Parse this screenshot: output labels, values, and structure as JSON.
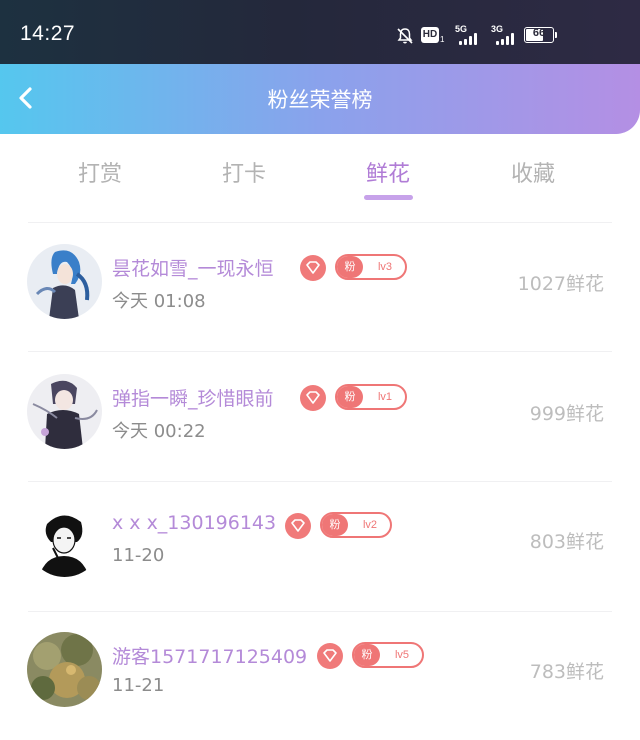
{
  "status_bar": {
    "time": "14:27",
    "hd_label": "HD",
    "hd_sub": "1",
    "network1": "5G",
    "network2": "3G",
    "battery": "66"
  },
  "header": {
    "title": "粉丝荣誉榜"
  },
  "tabs": [
    {
      "label": "打赏",
      "active": false
    },
    {
      "label": "打卡",
      "active": false
    },
    {
      "label": "鲜花",
      "active": true
    },
    {
      "label": "收藏",
      "active": false
    }
  ],
  "fans": [
    {
      "name": "昙花如雪_一现永恒",
      "time": "今天 01:08",
      "badge_prefix": "粉",
      "level": "lv3",
      "amount": "1027鲜花",
      "avatar": "anime-avatar-blue-hair"
    },
    {
      "name": "弹指一瞬_珍惜眼前",
      "time": "今天 00:22",
      "badge_prefix": "粉",
      "level": "lv1",
      "amount": "999鲜花",
      "avatar": "anime-avatar-dark"
    },
    {
      "name": "x x x_130196143",
      "time": "11-20",
      "badge_prefix": "粉",
      "level": "lv2",
      "amount": "803鲜花",
      "avatar": "sketch-avatar-bw"
    },
    {
      "name": "游客1571717125409",
      "time": "11-21",
      "badge_prefix": "粉",
      "level": "lv5",
      "amount": "783鲜花",
      "avatar": "plant-photo-avatar"
    }
  ],
  "colors": {
    "accent_purple": "#b07cd6",
    "badge_red": "#ef7676",
    "header_gradient_start": "#55c7ee",
    "header_gradient_end": "#b48fe4"
  }
}
